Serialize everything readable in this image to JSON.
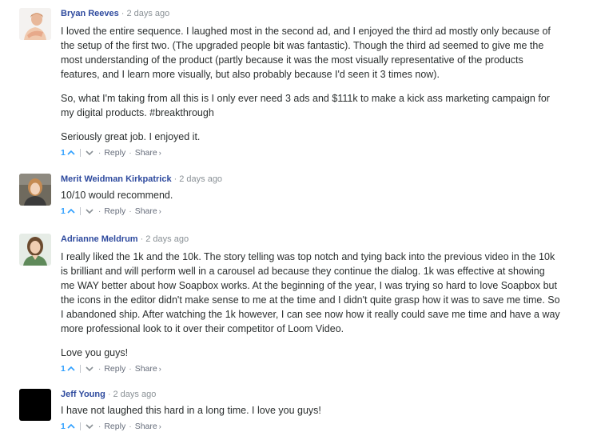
{
  "comments": [
    {
      "author": "Bryan Reeves",
      "time": "2 days ago",
      "paragraphs": [
        "I loved the entire sequence. I laughed most in the second ad, and I enjoyed the third ad mostly only because of the setup of the first two. (The upgraded people bit was fantastic). Though the third ad seemed to give me the most understanding of the product (partly because it was the most visually representative of the products features, and I learn more visually, but also probably because I'd seen it 3 times now).",
        "So, what I'm taking from all this is I only ever need 3 ads and $111k to make a kick ass marketing campaign for my digital products. #breakthrough",
        "Seriously great job. I enjoyed it."
      ],
      "upvotes": "1",
      "reply_label": "Reply",
      "share_label": "Share"
    },
    {
      "author": "Merit Weidman Kirkpatrick",
      "time": "2 days ago",
      "paragraphs": [
        "10/10 would recommend."
      ],
      "upvotes": "1",
      "reply_label": "Reply",
      "share_label": "Share"
    },
    {
      "author": "Adrianne Meldrum",
      "time": "2 days ago",
      "paragraphs": [
        "I really liked the 1k and the 10k. The story telling was top notch and tying back into the previous video in the 10k is brilliant and will perform well in a carousel ad because they continue the dialog. 1k was effective at showing me WAY better about how Soapbox works. At the beginning of the year, I was trying so hard to love Soapbox but the icons in the editor didn't make sense to me at the time and I didn't quite grasp how it was to save me time. So I abandoned ship. After watching the 1k however, I can see now how it really could save me time and have a way more professional look to it over their competitor of Loom Video.",
        "Love you guys!"
      ],
      "upvotes": "1",
      "reply_label": "Reply",
      "share_label": "Share"
    },
    {
      "author": "Jeff Young",
      "time": "2 days ago",
      "paragraphs": [
        "I have not laughed this hard in a long time. I love you guys!"
      ],
      "upvotes": "1",
      "reply_label": "Reply",
      "share_label": "Share"
    }
  ],
  "colors": {
    "author": "#2e4a9e",
    "upvote": "#2e9fff",
    "meta": "#8a9196",
    "text": "#2a2e2e"
  },
  "icons": {
    "upvote": "chevron-up-icon",
    "downvote": "chevron-down-icon",
    "share": "share-arrow-icon"
  }
}
